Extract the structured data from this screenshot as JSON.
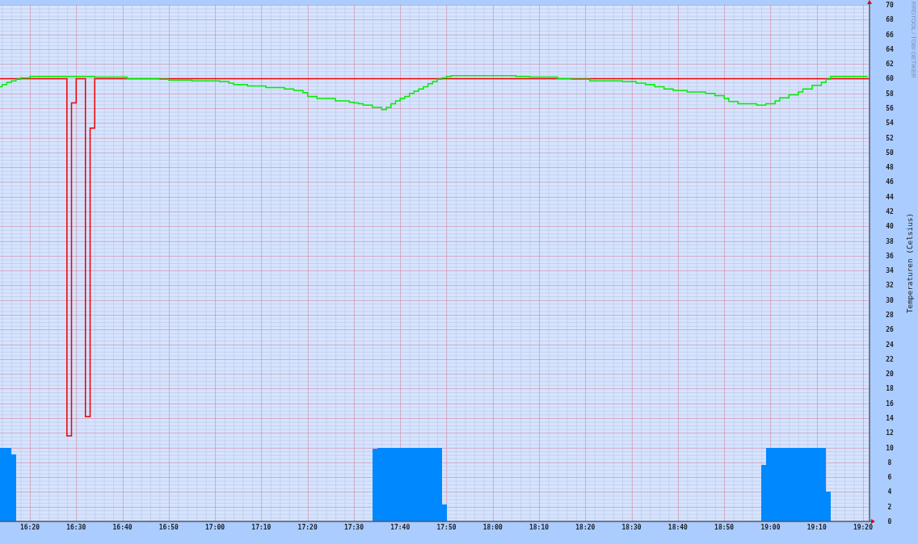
{
  "chart": {
    "credit": "RRDTOOL / TOBI OETIKER",
    "chart_data": {
      "type": "line",
      "ylabel": "Temperaturen (Celsius)",
      "grid": true,
      "xlim": [
        973.54,
        1161.4
      ],
      "ylim": [
        0,
        70
      ],
      "xticks": [
        {
          "value": 980,
          "label": "16:20"
        },
        {
          "value": 990,
          "label": "16:30"
        },
        {
          "value": 1000,
          "label": "16:40"
        },
        {
          "value": 1010,
          "label": "16:50"
        },
        {
          "value": 1020,
          "label": "17:00"
        },
        {
          "value": 1030,
          "label": "17:10"
        },
        {
          "value": 1040,
          "label": "17:20"
        },
        {
          "value": 1050,
          "label": "17:30"
        },
        {
          "value": 1060,
          "label": "17:40"
        },
        {
          "value": 1070,
          "label": "17:50"
        },
        {
          "value": 1080,
          "label": "18:00"
        },
        {
          "value": 1090,
          "label": "18:10"
        },
        {
          "value": 1100,
          "label": "18:20"
        },
        {
          "value": 1110,
          "label": "18:30"
        },
        {
          "value": 1120,
          "label": "18:40"
        },
        {
          "value": 1130,
          "label": "18:50"
        },
        {
          "value": 1140,
          "label": "19:00"
        },
        {
          "value": 1150,
          "label": "19:10"
        },
        {
          "value": 1160,
          "label": "19:20"
        }
      ],
      "yticks": [
        0,
        2,
        4,
        6,
        8,
        10,
        12,
        14,
        16,
        18,
        20,
        22,
        24,
        26,
        28,
        30,
        32,
        34,
        36,
        38,
        40,
        42,
        44,
        46,
        48,
        50,
        52,
        54,
        56,
        58,
        60,
        62,
        64,
        66,
        68,
        70
      ],
      "x": [
        973.54,
        974,
        974,
        975,
        975,
        976,
        976,
        977,
        977,
        978,
        978,
        980,
        980,
        988,
        988,
        989,
        989,
        990,
        990,
        992,
        992,
        993,
        993,
        994,
        994,
        1001,
        1001,
        1008,
        1008,
        1010,
        1010,
        1015,
        1015,
        1021,
        1021,
        1023,
        1023,
        1024,
        1024,
        1027,
        1027,
        1031,
        1031,
        1035,
        1035,
        1037,
        1037,
        1039,
        1039,
        1040,
        1040,
        1042,
        1042,
        1046,
        1046,
        1049,
        1049,
        1050,
        1050,
        1051,
        1051,
        1052,
        1052,
        1054,
        1054,
        1055,
        1055,
        1056,
        1056,
        1057,
        1057,
        1058,
        1058,
        1059,
        1059,
        1060,
        1060,
        1061,
        1061,
        1062,
        1062,
        1063,
        1063,
        1064,
        1064,
        1065,
        1065,
        1066,
        1066,
        1067,
        1067,
        1068,
        1068,
        1069,
        1069,
        1070,
        1070,
        1071,
        1071,
        1085,
        1085,
        1088,
        1088,
        1094,
        1094,
        1097,
        1097,
        1101,
        1101,
        1108,
        1108,
        1111,
        1111,
        1113,
        1113,
        1115,
        1115,
        1117,
        1117,
        1119,
        1119,
        1122,
        1122,
        1126,
        1126,
        1128,
        1128,
        1130,
        1130,
        1131,
        1131,
        1133,
        1133,
        1137,
        1137,
        1138,
        1138,
        1139,
        1139,
        1141,
        1141,
        1142,
        1142,
        1144,
        1144,
        1146,
        1146,
        1147,
        1147,
        1149,
        1149,
        1151,
        1151,
        1152,
        1152,
        1153,
        1153,
        1161,
        1161.4
      ],
      "series": [
        {
          "type": "area",
          "color": "#0088ff",
          "values": [
            10,
            10,
            10,
            10,
            10,
            10,
            9.1,
            9.1,
            0,
            0,
            0,
            0,
            0,
            0,
            0,
            0,
            0,
            0,
            0,
            0,
            0,
            0,
            0,
            0,
            0,
            0,
            0,
            0,
            0,
            0,
            0,
            0,
            0,
            0,
            0,
            0,
            0,
            0,
            0,
            0,
            0,
            0,
            0,
            0,
            0,
            0,
            0,
            0,
            0,
            0,
            0,
            0,
            0,
            0,
            0,
            0,
            0,
            0,
            0,
            0,
            0,
            0,
            0,
            0,
            9.8,
            9.8,
            10,
            10,
            10,
            10,
            10,
            10,
            10,
            10,
            10,
            10,
            10,
            10,
            10,
            10,
            10,
            10,
            10,
            10,
            10,
            10,
            10,
            10,
            10,
            10,
            10,
            10,
            10,
            10,
            2.3,
            2.3,
            0,
            0,
            0,
            0,
            0,
            0,
            0,
            0,
            0,
            0,
            0,
            0,
            0,
            0,
            0,
            0,
            0,
            0,
            0,
            0,
            0,
            0,
            0,
            0,
            0,
            0,
            0,
            0,
            0,
            0,
            0,
            0,
            0,
            0,
            0,
            0,
            0,
            0,
            0,
            0,
            7.7,
            7.7,
            10,
            10,
            10,
            10,
            10,
            10,
            10,
            10,
            10,
            10,
            10,
            10,
            10,
            10,
            10,
            10,
            4,
            4,
            0,
            0,
            0
          ]
        },
        {
          "type": "line",
          "color": "#ee0000",
          "values": [
            60,
            60,
            60,
            60,
            60,
            60,
            60,
            60,
            60,
            60,
            60,
            60,
            60,
            60,
            11.6,
            11.6,
            56.7,
            56.7,
            60,
            60,
            14.2,
            14.2,
            53.3,
            53.3,
            60,
            60,
            60,
            60,
            60,
            60,
            60,
            60,
            60,
            60,
            60,
            60,
            60,
            60,
            60,
            60,
            60,
            60,
            60,
            60,
            60,
            60,
            60,
            60,
            60,
            60,
            60,
            60,
            60,
            60,
            60,
            60,
            60,
            60,
            60,
            60,
            60,
            60,
            60,
            60,
            60,
            60,
            60,
            60,
            60,
            60,
            60,
            60,
            60,
            60,
            60,
            60,
            60,
            60,
            60,
            60,
            60,
            60,
            60,
            60,
            60,
            60,
            60,
            60,
            60,
            60,
            60,
            60,
            60,
            60,
            60,
            60,
            60,
            60,
            60,
            60,
            60,
            60,
            60,
            60,
            60,
            60,
            60,
            60,
            60,
            60,
            60,
            60,
            60,
            60,
            60,
            60,
            60,
            60,
            60,
            60,
            60,
            60,
            60,
            60,
            60,
            60,
            60,
            60,
            60,
            60,
            60,
            60,
            60,
            60,
            60,
            60,
            60,
            60,
            60,
            60,
            60,
            60,
            60,
            60,
            60,
            60,
            60,
            60,
            60,
            60,
            60,
            60,
            60,
            60,
            60,
            60,
            60,
            60,
            60
          ]
        },
        {
          "type": "line",
          "color": "#00ee00",
          "values": [
            58.9,
            58.9,
            59.2,
            59.2,
            59.5,
            59.5,
            59.7,
            59.7,
            59.9,
            59.9,
            60.1,
            60.1,
            60.3,
            60.3,
            60.3,
            60.3,
            60.3,
            60.3,
            60.3,
            60.3,
            60.3,
            60.3,
            60.3,
            60.3,
            60.2,
            60.2,
            60,
            60,
            59.9,
            59.9,
            59.8,
            59.8,
            59.7,
            59.7,
            59.6,
            59.6,
            59.4,
            59.4,
            59.2,
            59.2,
            59,
            59,
            58.8,
            58.8,
            58.6,
            58.6,
            58.4,
            58.4,
            58.1,
            58.1,
            57.6,
            57.6,
            57.3,
            57.3,
            57,
            57,
            56.8,
            56.8,
            56.7,
            56.7,
            56.6,
            56.6,
            56.4,
            56.4,
            56.1,
            56.1,
            56.1,
            56.1,
            55.8,
            55.8,
            56.1,
            56.1,
            56.6,
            56.6,
            57,
            57,
            57.3,
            57.3,
            57.6,
            57.6,
            58,
            58,
            58.3,
            58.3,
            58.6,
            58.6,
            58.9,
            58.9,
            59.3,
            59.3,
            59.6,
            59.6,
            59.9,
            59.9,
            60.1,
            60.1,
            60.3,
            60.3,
            60.4,
            60.4,
            60.3,
            60.3,
            60.2,
            60.2,
            60,
            60,
            59.9,
            59.9,
            59.7,
            59.7,
            59.6,
            59.6,
            59.4,
            59.4,
            59.2,
            59.2,
            58.9,
            58.9,
            58.6,
            58.6,
            58.4,
            58.4,
            58.2,
            58.2,
            58,
            58,
            57.7,
            57.7,
            57.3,
            57.3,
            56.9,
            56.9,
            56.6,
            56.6,
            56.4,
            56.4,
            56.4,
            56.4,
            56.6,
            56.6,
            57,
            57,
            57.4,
            57.4,
            57.8,
            57.8,
            58.2,
            58.2,
            58.6,
            58.6,
            59.1,
            59.1,
            59.5,
            59.5,
            59.9,
            59.9,
            60.3,
            60.3,
            null
          ]
        }
      ]
    }
  }
}
